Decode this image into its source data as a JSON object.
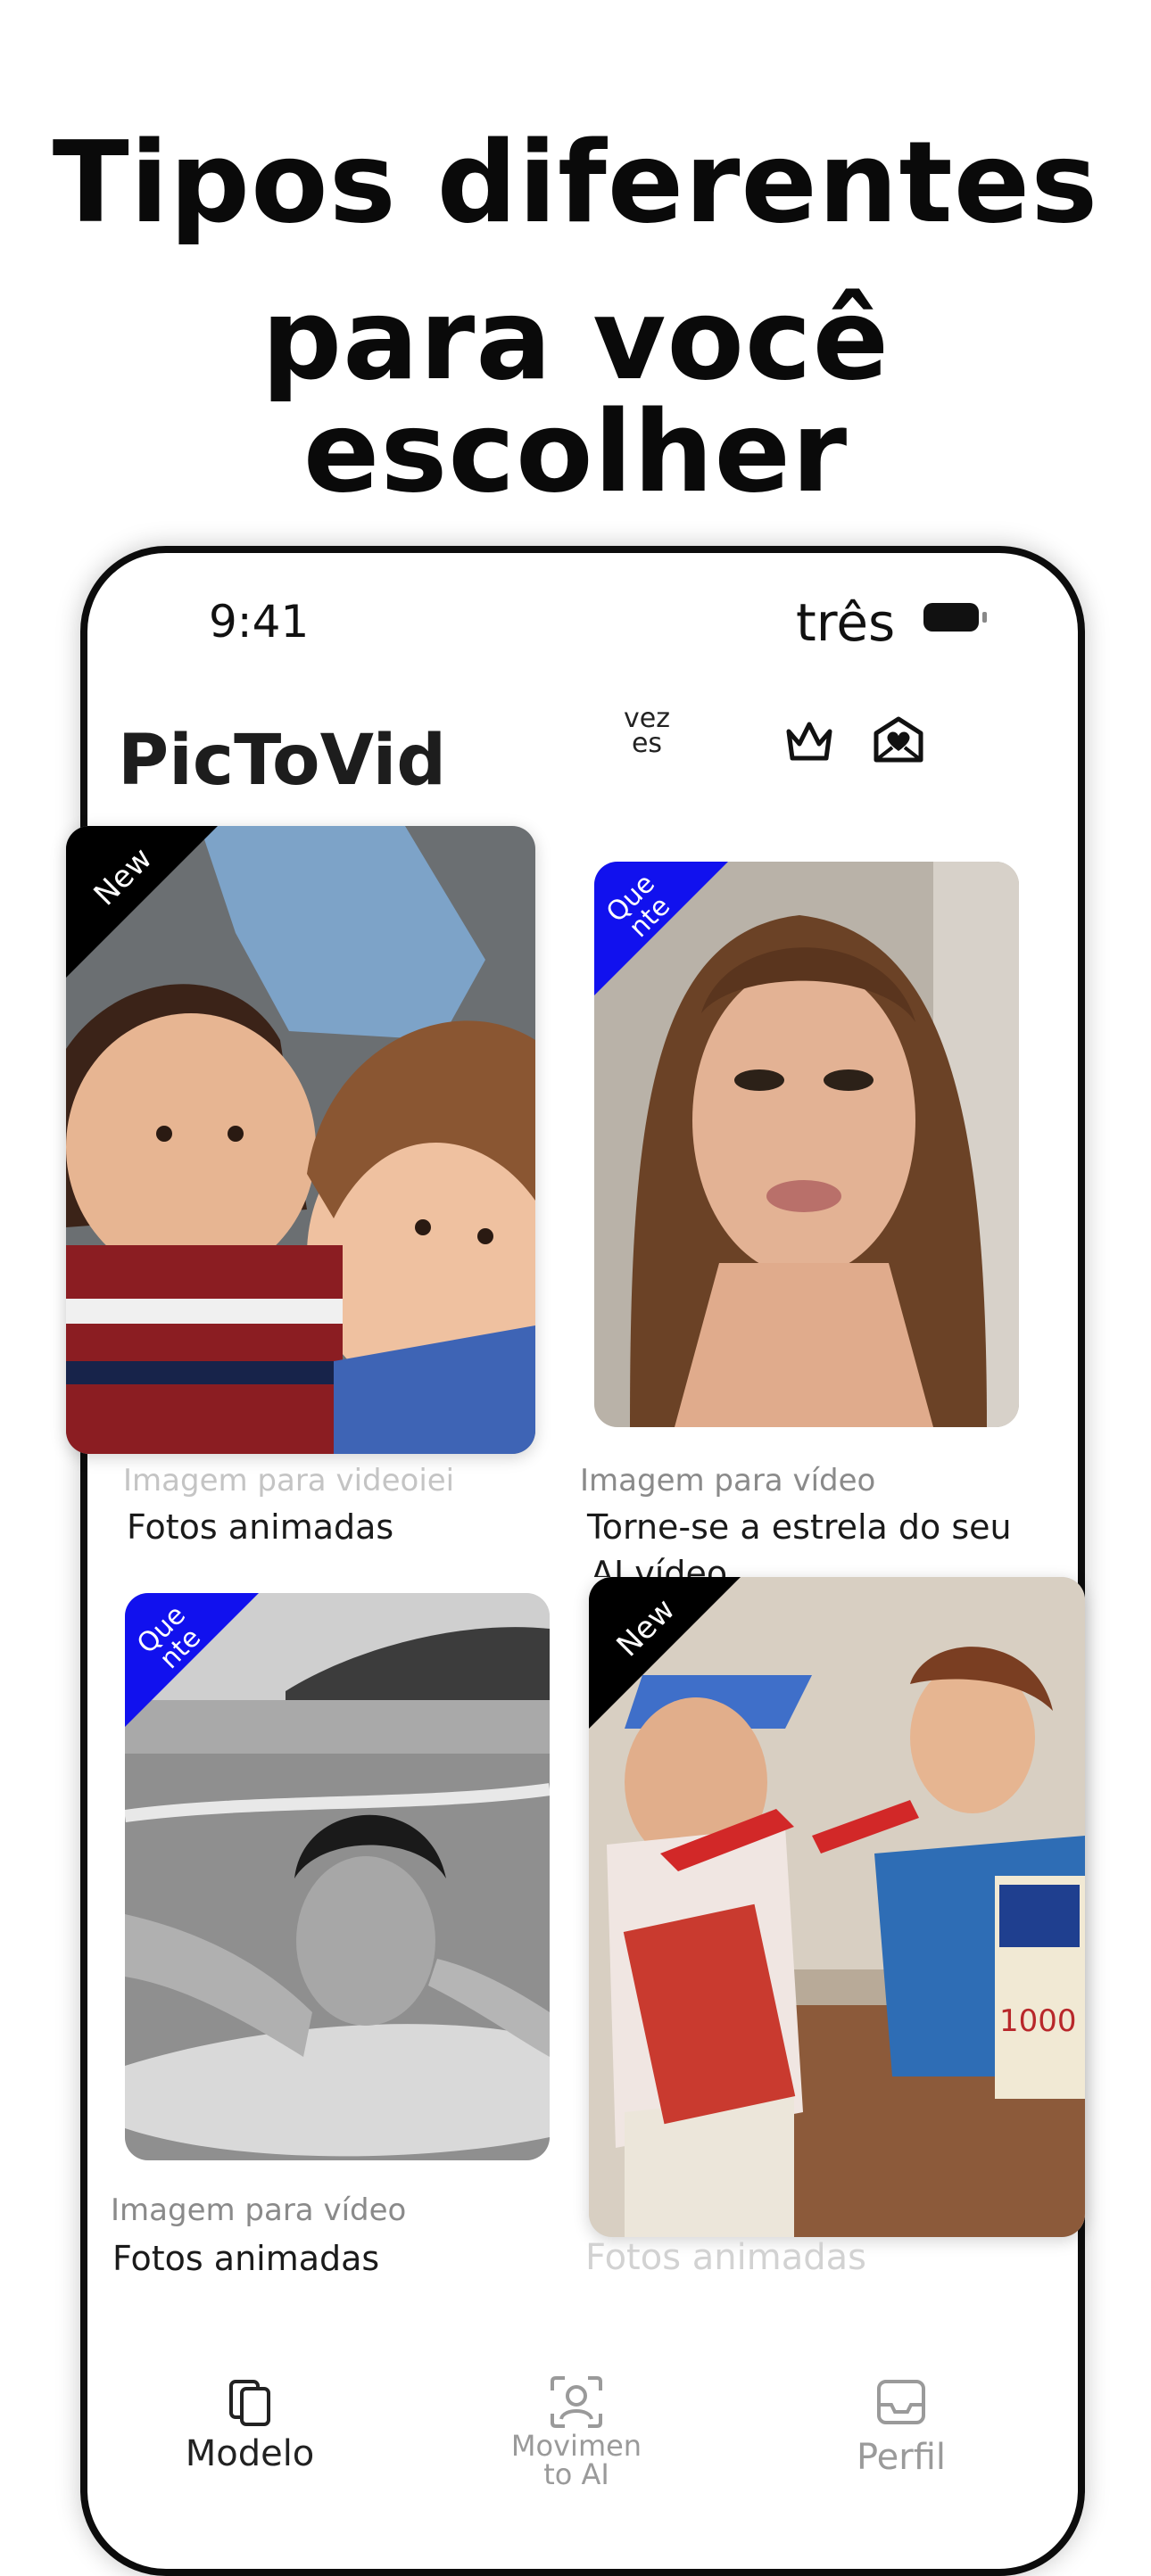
{
  "headline": {
    "line1": "Tipos diferentes",
    "line2": "para você escolher"
  },
  "status_bar": {
    "time": "9:41",
    "carrier": "três"
  },
  "app_bar": {
    "title": "PicToVid",
    "credits_label": "vez\nes",
    "premium_icon": "crown-icon",
    "messages_icon": "heart-mail-icon"
  },
  "templates": [
    {
      "badge": "New",
      "badge_color": "#000000",
      "subtitle": "Imagem para videoiei",
      "title": "Fotos animadas"
    },
    {
      "badge": "Que\nnte",
      "badge_color": "#1111ee",
      "subtitle": "Imagem para vídeo",
      "title": "Torne-se a estrela do seu",
      "title_overflow": "AI vídeo"
    },
    {
      "badge": "Que\nnte",
      "badge_color": "#1111ee",
      "subtitle": "Imagem para vídeo",
      "title": "Fotos animadas"
    },
    {
      "badge": "New",
      "badge_color": "#000000",
      "overlay_number": "1000",
      "title": "Fotos animadas"
    }
  ],
  "bottom_nav": {
    "items": [
      {
        "label": "Modelo",
        "icon": "template-stack-icon",
        "active": true
      },
      {
        "label": "Movimen\nto AI",
        "icon": "face-scan-icon",
        "active": false
      },
      {
        "label": "Perfil",
        "icon": "inbox-icon",
        "active": false
      }
    ]
  },
  "colors": {
    "active_nav": "#222222",
    "inactive_nav": "#9a9a9a",
    "hot_badge": "#1111ee"
  }
}
